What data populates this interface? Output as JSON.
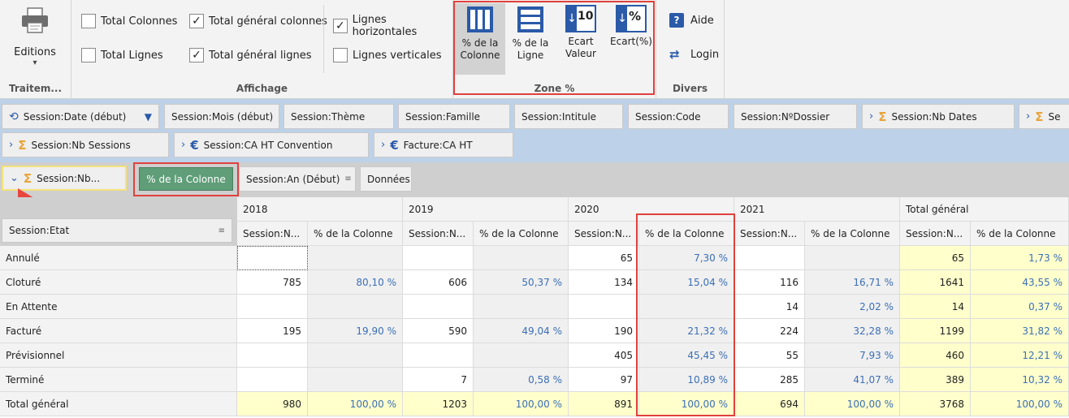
{
  "ribbon": {
    "editions_label": "Editions",
    "editions_arrow": "▾",
    "traitement_label": "Traitem...",
    "affichage": {
      "label": "Affichage",
      "total_colonnes": {
        "label": "Total Colonnes",
        "checked": false
      },
      "total_lignes": {
        "label": "Total Lignes",
        "checked": false
      },
      "total_general_colonnes": {
        "label": "Total général colonnes",
        "checked": true
      },
      "total_general_lignes": {
        "label": "Total général lignes",
        "checked": true
      },
      "lignes_horizontales": {
        "label": "Lignes horizontales",
        "checked": true
      },
      "lignes_verticales": {
        "label": "Lignes verticales",
        "checked": false
      }
    },
    "zone": {
      "label": "Zone %",
      "pct_colonne": "% de la\nColonne",
      "pct_ligne": "% de la\nLigne",
      "ecart_valeur": "Ecart\nValeur",
      "ecart_pct": "Ecart(%)",
      "ecart_valeur_icon_text": "10",
      "ecart_pct_icon_text": "%"
    },
    "divers": {
      "label": "Divers",
      "aide": "Aide",
      "login": "Login"
    }
  },
  "fields": {
    "row1": [
      "Session:Date (début)",
      "Session:Mois (début)",
      "Session:Thème",
      "Session:Famille",
      "Session:Intitule",
      "Session:Code",
      "Session:NºDossier",
      "Session:Nb Dates",
      "Se"
    ],
    "row2": [
      "Session:Nb Sessions",
      "Session:CA HT Convention",
      "Facture:CA HT"
    ]
  },
  "pivot": {
    "data_field": "Session:Nb...",
    "pct_button": "% de la Colonne",
    "col_field": "Session:An (Début)",
    "donnees": "Données",
    "row_field": "Session:Etat",
    "years": [
      "2018",
      "2019",
      "2020",
      "2021",
      "Total général"
    ],
    "sub_headers": [
      "Session:N...",
      "% de la Colonne"
    ],
    "rows": [
      {
        "label": "Annulé",
        "cells": [
          "",
          "",
          "",
          "",
          "65",
          "7,30 %",
          "",
          "",
          "65",
          "1,73 %"
        ]
      },
      {
        "label": "Cloturé",
        "cells": [
          "785",
          "80,10 %",
          "606",
          "50,37 %",
          "134",
          "15,04 %",
          "116",
          "16,71 %",
          "1641",
          "43,55 %"
        ]
      },
      {
        "label": "En Attente",
        "cells": [
          "",
          "",
          "",
          "",
          "",
          "",
          "14",
          "2,02 %",
          "14",
          "0,37 %"
        ]
      },
      {
        "label": "Facturé",
        "cells": [
          "195",
          "19,90 %",
          "590",
          "49,04 %",
          "190",
          "21,32 %",
          "224",
          "32,28 %",
          "1199",
          "31,82 %"
        ]
      },
      {
        "label": "Prévisionnel",
        "cells": [
          "",
          "",
          "",
          "",
          "405",
          "45,45 %",
          "55",
          "7,93 %",
          "460",
          "12,21 %"
        ]
      },
      {
        "label": "Terminé",
        "cells": [
          "",
          "",
          "7",
          "0,58 %",
          "97",
          "10,89 %",
          "285",
          "41,07 %",
          "389",
          "10,32 %"
        ]
      }
    ],
    "total_row": {
      "label": "Total général",
      "cells": [
        "980",
        "100,00 %",
        "1203",
        "100,00 %",
        "891",
        "100,00 %",
        "694",
        "100,00 %",
        "3768",
        "100,00 %"
      ]
    }
  },
  "colors": {
    "pct_text": "#3b6fb6",
    "highlight_yellow": "#ffffcc",
    "pct_button_bg": "#5f9e78",
    "annotation_red": "#e0413c",
    "icon_blue": "#2a5aa8"
  }
}
